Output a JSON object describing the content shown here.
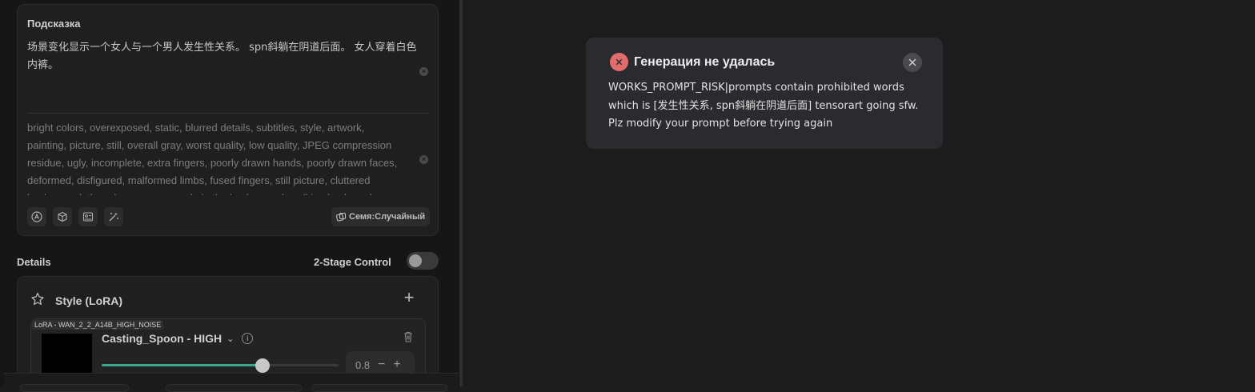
{
  "prompt": {
    "title": "Подсказка",
    "positive": "场景变化显示一个女人与一个男人发生性关系。 spn斜躺在阴道后面。 女人穿着白色内裤。",
    "negative": "bright colors, overexposed, static, blurred details, subtitles, style, artwork, painting, picture, still, overall gray, worst quality, low quality, JPEG compression residue, ugly, incomplete, extra fingers, poorly drawn hands, poorly drawn faces, deformed, disfigured, malformed limbs, fused fingers, still picture, cluttered background, three legs, many people in the background, walking backwards",
    "seed_label": "Семя:Случайный"
  },
  "details": {
    "label": "Details",
    "two_stage_label": "2-Stage Control",
    "two_stage_on": false
  },
  "lora": {
    "section_title": "Style (LoRA)",
    "item": {
      "tag": "LoRA - WAN_2_2_A14B_HIGH_NOISE",
      "name": "Casting_Spoon - HIGH",
      "weight": "0.8",
      "weight_fraction": 0.68
    }
  },
  "toast": {
    "title": "Генерация не удалась",
    "message": "WORKS_PROMPT_RISK|prompts contain prohibited words which is [发生性关系, spn斜躺在阴道后面] tensorart going sfw. Plz modify your prompt before trying again"
  },
  "icons": [
    "clear-icon",
    "auto-tag-icon",
    "cube-icon",
    "image-card-icon",
    "magic-wand-icon",
    "dice-icon",
    "lora-badge-icon",
    "plus-icon",
    "chevron-down-icon",
    "info-icon",
    "trash-icon",
    "error-icon",
    "close-icon"
  ],
  "colors": {
    "accent": "#3aa88a",
    "error": "#e26b6b",
    "toast_bg": "#2b2b2f"
  }
}
